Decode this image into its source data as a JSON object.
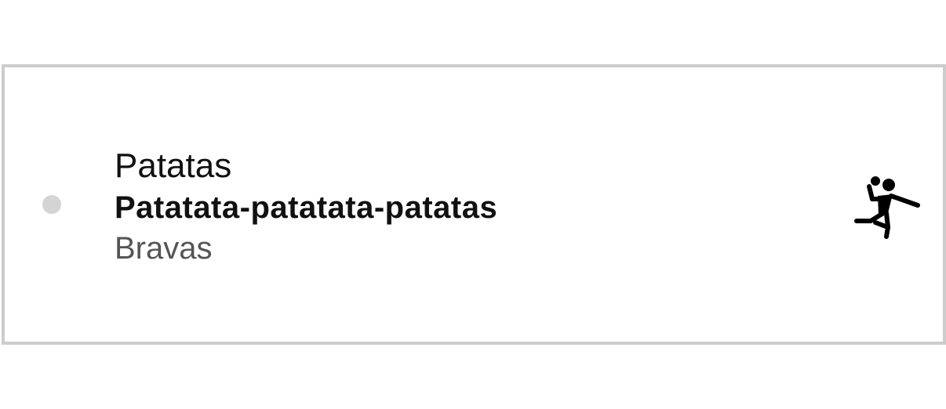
{
  "item": {
    "title": "Patatas",
    "subtitle": "Patatata-patatata-patatas",
    "detail": "Bravas",
    "icon": "handball-player-icon",
    "status_dot_color": "#d4d4d4"
  }
}
